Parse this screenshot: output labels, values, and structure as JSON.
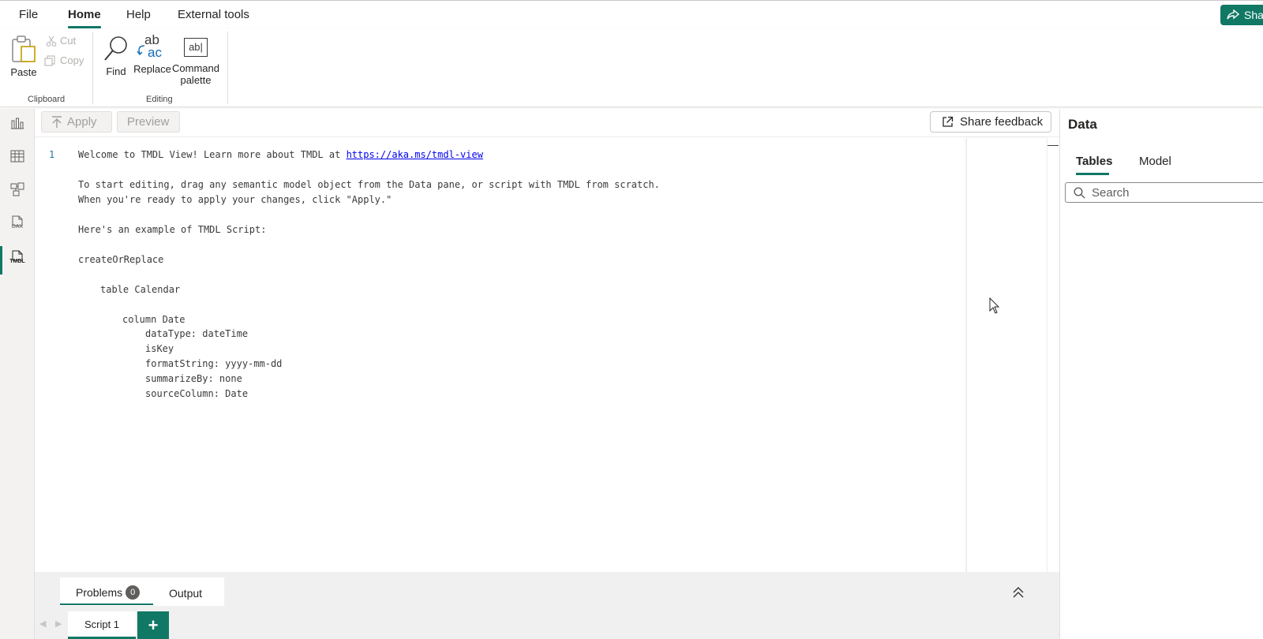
{
  "menu": {
    "items": [
      {
        "label": "File"
      },
      {
        "label": "Home"
      },
      {
        "label": "Help"
      },
      {
        "label": "External tools"
      }
    ],
    "share_label": "Sha"
  },
  "ribbon": {
    "paste": "Paste",
    "cut": "Cut",
    "copy": "Copy",
    "clipboard_group": "Clipboard",
    "find": "Find",
    "replace": "Replace",
    "command_palette_1": "Command",
    "command_palette_2": "palette",
    "editing_group": "Editing",
    "replace_icon_top": "ab",
    "replace_icon_bottom": "ac",
    "palette_icon_text": "ab|"
  },
  "rail": {
    "items": [
      "report-view-icon",
      "table-view-icon",
      "model-view-icon",
      "dax-query-view-icon",
      "tmdl-view-icon"
    ],
    "dax_label": "DAX",
    "tmdl_label": "TMDL"
  },
  "toolbar": {
    "apply": "Apply",
    "preview": "Preview",
    "feedback": "Share feedback"
  },
  "editor": {
    "line_number": "1",
    "lines": [
      {
        "prefix": "Welcome to TMDL View! Learn more about TMDL at ",
        "link": "https://aka.ms/tmdl-view"
      },
      {
        "text": "To start editing, drag any semantic model object from the Data pane, or script with TMDL from scratch."
      },
      {
        "text": "When you're ready to apply your changes, click \"Apply.\""
      },
      {
        "text": "Here's an example of TMDL Script:"
      },
      {
        "text": "createOrReplace"
      },
      {
        "text": "table Calendar"
      },
      {
        "text": "column Date"
      },
      {
        "text": "dataType: dateTime"
      },
      {
        "text": "isKey"
      },
      {
        "text": "formatString: yyyy-mm-dd"
      },
      {
        "text": "summarizeBy: none"
      },
      {
        "text": "sourceColumn: Date"
      }
    ]
  },
  "data_pane": {
    "title": "Data",
    "tabs": [
      {
        "label": "Tables"
      },
      {
        "label": "Model"
      }
    ],
    "search_placeholder": "Search"
  },
  "bottom": {
    "problems_label": "Problems",
    "problems_count": "0",
    "output_label": "Output",
    "script_tab": "Script 1",
    "add_tab": "+"
  },
  "colors": {
    "accent": "#117865",
    "link": "#0000ee"
  }
}
